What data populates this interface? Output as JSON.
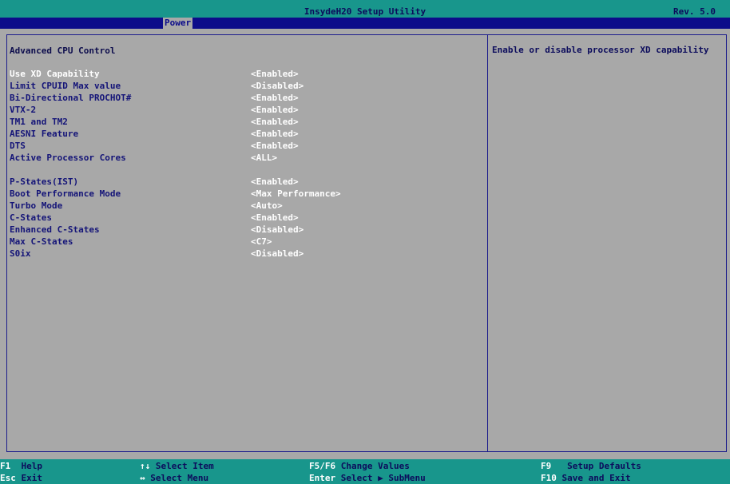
{
  "title_bar": {
    "title": "InsydeH20 Setup Utility",
    "revision": "Rev. 5.0"
  },
  "menu": {
    "tabs": [
      {
        "label": "Power",
        "active": true
      }
    ]
  },
  "main": {
    "section_title": "Advanced CPU Control",
    "groups": [
      [
        {
          "label": "Use XD Capability",
          "value": "<Enabled>",
          "selected": true
        },
        {
          "label": "Limit CPUID Max value",
          "value": "<Disabled>"
        },
        {
          "label": "Bi-Directional PROCHOT#",
          "value": "<Enabled>"
        },
        {
          "label": "VTX-2",
          "value": "<Enabled>"
        },
        {
          "label": "TM1 and TM2",
          "value": "<Enabled>"
        },
        {
          "label": "AESNI Feature",
          "value": "<Enabled>"
        },
        {
          "label": "DTS",
          "value": "<Enabled>"
        },
        {
          "label": "Active Processor Cores",
          "value": "<ALL>"
        }
      ],
      [
        {
          "label": "P-States(IST)",
          "value": "<Enabled>"
        },
        {
          "label": "Boot Performance Mode",
          "value": "<Max Performance>"
        },
        {
          "label": "Turbo Mode",
          "value": "<Auto>"
        },
        {
          "label": "C-States",
          "value": "<Enabled>"
        },
        {
          "label": "Enhanced C-States",
          "value": "<Disabled>"
        },
        {
          "label": "Max C-States",
          "value": "<C7>"
        },
        {
          "label": "S0ix",
          "value": "<Disabled>"
        }
      ]
    ]
  },
  "help": {
    "text": "Enable or disable processor XD capability"
  },
  "status_bar": {
    "hints": [
      {
        "key": "F1",
        "desc": "Help"
      },
      {
        "key": "Esc",
        "desc": "Exit"
      },
      {
        "key": "↑↓",
        "desc": "Select Item"
      },
      {
        "key": "↔",
        "desc": "Select Menu"
      },
      {
        "key": "F5/F6",
        "desc": "Change Values"
      },
      {
        "key": "Enter",
        "desc": "Select ▶ SubMenu"
      },
      {
        "key": "F9",
        "desc": "Setup Defaults"
      },
      {
        "key": "F10",
        "desc": "Save and Exit"
      }
    ]
  },
  "colors": {
    "background": "#a8a8a8",
    "title_bar": "#18968c",
    "menu_bar": "#0c0c8a",
    "highlight_text": "#ffffff",
    "label_text": "#141478"
  }
}
